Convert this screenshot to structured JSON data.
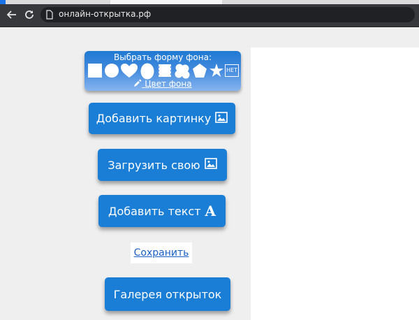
{
  "browser": {
    "url": "онлайн-открытка.рф",
    "icons": [
      "back-arrow-icon",
      "reload-icon",
      "page-icon"
    ]
  },
  "shape_panel": {
    "title": "Выбрать форму фона:",
    "shapes": [
      "square",
      "circle",
      "heart",
      "ellipse",
      "stamp",
      "flower",
      "pentagon",
      "star"
    ],
    "none_label": "НЕТ",
    "color_link": "Цвет фона",
    "color_icon": "eyedropper-icon"
  },
  "buttons": {
    "add_picture": "Добавить картинку",
    "upload_own": "Загрузить свою",
    "add_text": "Добавить текст",
    "add_text_glyph": "A",
    "save": "Сохранить",
    "gallery": "Галерея открыток"
  },
  "colors": {
    "button_blue": "#1a7ed6",
    "toolbar": "#36383b",
    "link": "#1a5fc4"
  }
}
